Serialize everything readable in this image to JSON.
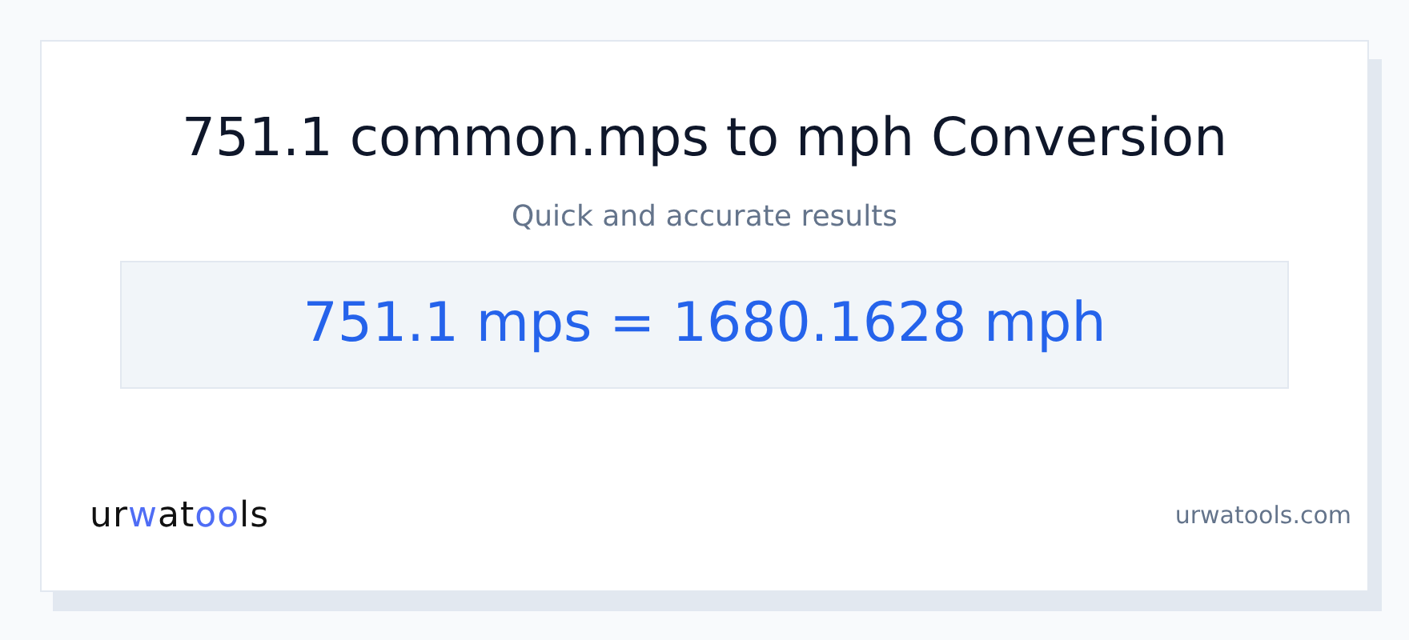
{
  "title": "751.1 common.mps to mph Conversion",
  "subtitle": "Quick and accurate results",
  "result": "751.1 mps = 1680.1628 mph",
  "logo": [
    {
      "text": "ur",
      "accent": false
    },
    {
      "text": "w",
      "accent": true
    },
    {
      "text": "at",
      "accent": false
    },
    {
      "text": "oo",
      "accent": true
    },
    {
      "text": "ls",
      "accent": false
    }
  ],
  "site": "urwatools.com"
}
